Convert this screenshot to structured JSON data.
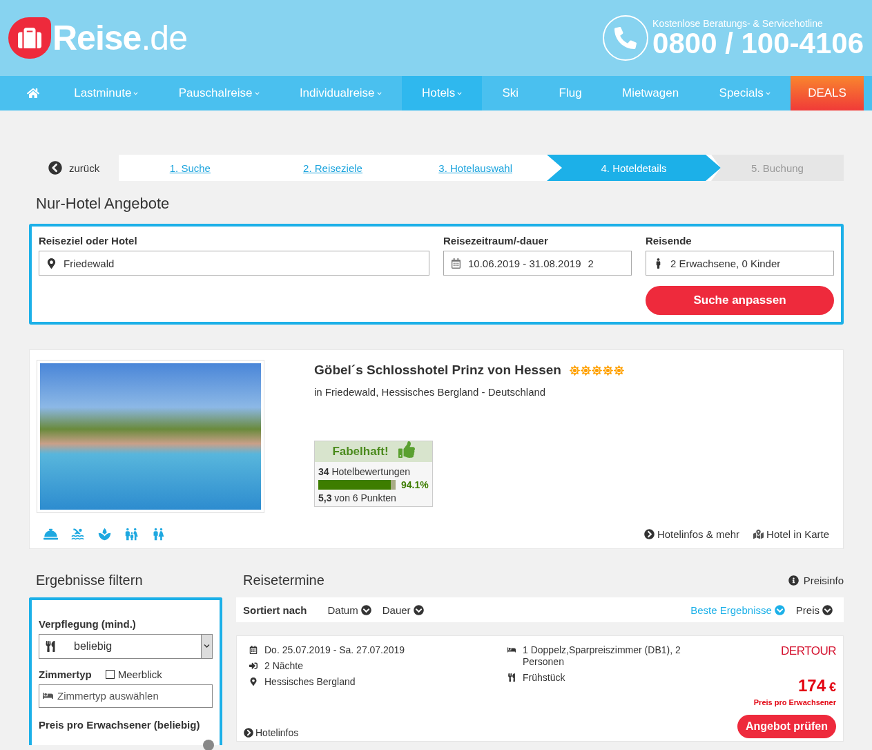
{
  "header": {
    "logo": "**Reise**.de",
    "hotline_label": "Kostenlose Beratungs- & Servicehotline",
    "hotline_number": "0800 / 100-4106"
  },
  "nav": [
    {
      "kind": "home",
      "selected": false
    },
    {
      "kind": "link",
      "label": "Lastminute",
      "selected": false,
      "has_menu": true
    },
    {
      "kind": "link",
      "label": "Pauschalreise",
      "selected": false,
      "has_menu": true
    },
    {
      "kind": "link",
      "label": "Individualreise",
      "selected": false,
      "has_menu": true
    },
    {
      "kind": "link",
      "label": "Hotels",
      "selected": true,
      "has_menu": true
    },
    {
      "kind": "link",
      "label": "Ski",
      "selected": false,
      "has_menu": false
    },
    {
      "kind": "link",
      "label": "Flug",
      "selected": false,
      "has_menu": false
    },
    {
      "kind": "link",
      "label": "Mietwagen",
      "selected": false,
      "has_menu": false
    },
    {
      "kind": "link",
      "label": "Specials",
      "selected": false,
      "has_menu": true
    },
    {
      "kind": "deal",
      "label": "DEALS",
      "has_menu": false
    }
  ],
  "back": "zurück",
  "steps": [
    {
      "label": "1. Suche",
      "selected": false,
      "completed": true
    },
    {
      "label": "2. Reiseziele",
      "selected": false,
      "completed": true
    },
    {
      "label": "3. Hotelauswahl",
      "selected": false,
      "completed": true
    },
    {
      "label": "4. Hoteldetails",
      "selected": true
    },
    {
      "label": "5. Buchung",
      "selected": false,
      "completed": false
    }
  ],
  "page_title": "Nur-Hotel Angebote",
  "search": {
    "destination": {
      "label": "Reiseziel oder Hotel",
      "value": "Friedewald"
    },
    "period": {
      "label": "Reisezeitraum/-dauer",
      "value": "10.06.2019 - 31.08.2019",
      "duration": "2"
    },
    "travellers": {
      "label": "Reisende",
      "value": "2 Erwachsene, 0 Kinder"
    },
    "button": "Suche anpassen"
  },
  "hotel": {
    "name": "Göbel´s Schlosshotel Prinz von Hessen",
    "stars": 5,
    "location": "in Friedewald, Hessisches Bergland - Deutschland",
    "rating": {
      "verdict": "Fabelhaft!",
      "reviews": "**34** Hotelbewertungen",
      "level": 0.941,
      "percent": "94.1%",
      "score": "**5,3** von 6 Punkten"
    },
    "links": [
      "Hotelinfos & mehr",
      "Hotel in Karte"
    ]
  },
  "filter": {
    "title": "Ergebnisse filtern",
    "board_label": "Verpflegung (mind.)",
    "board_value": "beliebig",
    "room_label": "Zimmertyp",
    "sea_view": {
      "label": "Meerblick",
      "checked": false
    },
    "room_placeholder": "Zimmertyp auswählen",
    "price_label": "Preis pro Erwachsener (beliebig)"
  },
  "results": {
    "title": "Reisetermine",
    "price_info": "Preisinfo",
    "sort_label": "Sortiert nach",
    "sort_options": [
      {
        "label": "Datum",
        "selected": false
      },
      {
        "label": "Dauer",
        "selected": false
      }
    ],
    "ranking_options": [
      {
        "label": "Beste Ergebnisse",
        "selected": true
      },
      {
        "label": "Preis",
        "selected": false
      }
    ],
    "offers": [
      {
        "dates": "Do. 25.07.2019 - Sa. 27.07.2019",
        "nights": "2 Nächte",
        "region": "Hessisches Bergland",
        "room": "1 Doppelz,Sparpreiszimmer (DB1), 2 Personen",
        "board": "Frühstück",
        "operator": "DERTOUR",
        "price": "174",
        "currency": "€",
        "price_note": "Preis pro Erwachsener",
        "button": "Angebot prüfen",
        "link": "Hotelinfos"
      }
    ]
  }
}
